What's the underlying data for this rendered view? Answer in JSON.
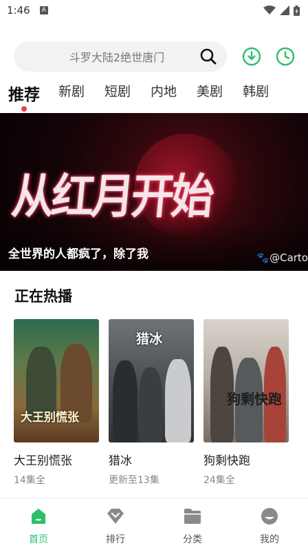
{
  "status_bar": {
    "time": "1:46",
    "notification_icon": "A"
  },
  "search": {
    "placeholder": "斗罗大陆2绝世唐门"
  },
  "top_icons": [
    "download-icon",
    "history-icon"
  ],
  "tabs": [
    {
      "label": "推荐",
      "active": true
    },
    {
      "label": "新剧",
      "active": false
    },
    {
      "label": "短剧",
      "active": false
    },
    {
      "label": "内地",
      "active": false
    },
    {
      "label": "美剧",
      "active": false
    },
    {
      "label": "韩剧",
      "active": false
    }
  ],
  "banner": {
    "title_art": "从红月开始",
    "caption": "全世界的人都疯了，除了我",
    "credit": "🐾@Carto"
  },
  "section": {
    "title": "正在热播"
  },
  "cards": [
    {
      "title": "大王别慌张",
      "subtitle": "14集全",
      "poster_text": "大王别慌张"
    },
    {
      "title": "猎冰",
      "subtitle": "更新至13集",
      "poster_text": "猎冰"
    },
    {
      "title": "狗剩快跑",
      "subtitle": "24集全",
      "poster_text": "狗剩快跑"
    }
  ],
  "bottom_nav": [
    {
      "label": "首页",
      "icon": "home-icon",
      "active": true
    },
    {
      "label": "排行",
      "icon": "ranking-icon",
      "active": false
    },
    {
      "label": "分类",
      "icon": "category-icon",
      "active": false
    },
    {
      "label": "我的",
      "icon": "profile-icon",
      "active": false
    }
  ],
  "colors": {
    "accent": "#2cbf6a",
    "tab_dot": "#e8453c"
  }
}
